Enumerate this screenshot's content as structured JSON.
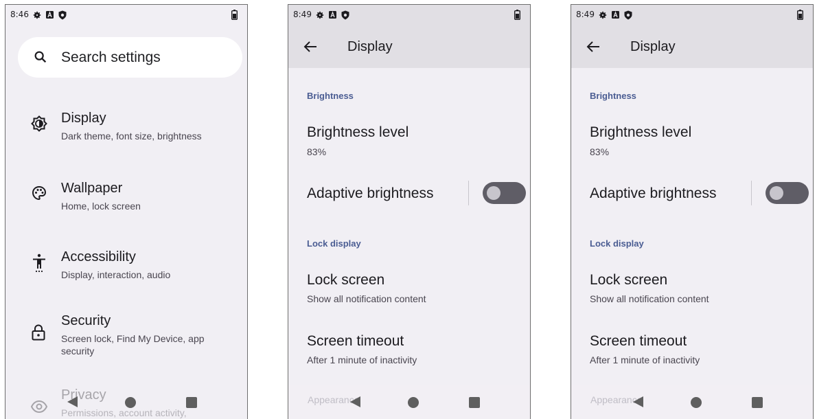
{
  "phone1": {
    "status": {
      "time": "8:46"
    },
    "search": {
      "placeholder": "Search settings"
    },
    "items": [
      {
        "title": "Display",
        "subtitle": "Dark theme, font size, brightness",
        "icon": "display-icon"
      },
      {
        "title": "Wallpaper",
        "subtitle": "Home, lock screen",
        "icon": "palette-icon"
      },
      {
        "title": "Accessibility",
        "subtitle": "Display, interaction, audio",
        "icon": "accessibility-icon"
      },
      {
        "title": "Security",
        "subtitle": "Screen lock, Find My Device, app security",
        "icon": "lock-icon"
      },
      {
        "title": "Privacy",
        "subtitle": "Permissions, account activity,",
        "icon": "privacy-icon"
      }
    ]
  },
  "phone2": {
    "status": {
      "time": "8:49"
    },
    "title": "Display",
    "brightness_category": "Brightness",
    "brightness_level": {
      "title": "Brightness level",
      "value": "83%"
    },
    "adaptive": {
      "title": "Adaptive brightness",
      "enabled": false
    },
    "lock_category": "Lock display",
    "lock_screen": {
      "title": "Lock screen",
      "subtitle": "Show all notification content"
    },
    "screen_timeout": {
      "title": "Screen timeout",
      "subtitle": "After 1 minute of inactivity"
    },
    "appearance_ghost": "Appearance"
  },
  "phone3": {
    "status": {
      "time": "8:49"
    },
    "title": "Display",
    "brightness_category": "Brightness",
    "brightness_level": {
      "title": "Brightness level",
      "value": "83%"
    },
    "adaptive": {
      "title": "Adaptive brightness",
      "enabled": false
    },
    "lock_category": "Lock display",
    "lock_screen": {
      "title": "Lock screen",
      "subtitle": "Show all notification content"
    },
    "screen_timeout": {
      "title": "Screen timeout",
      "subtitle": "After 1 minute of inactivity"
    },
    "appearance_ghost": "Appearance"
  },
  "colors": {
    "accent": "#4a5c92",
    "surface": "#f1eff4",
    "appbar": "#e1dfe4"
  }
}
